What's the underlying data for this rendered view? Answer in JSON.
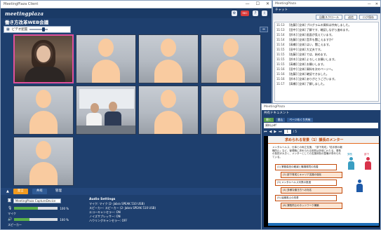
{
  "main_window": {
    "title": "MeetingPlaza Client",
    "controls": [
      "—",
      "☐",
      "✕"
    ],
    "brand": "meetingplaza",
    "toolbar_icons": [
      "settings-icon",
      "rec-icon",
      "help-icon",
      "info-icon"
    ],
    "toolbar_labels": [
      "⚙",
      "REC",
      "?",
      "i"
    ],
    "room_title": "働き方改革WEB会議",
    "layout_label": "ビデオ配置",
    "right_icon": "⇔"
  },
  "video_tiles": [
    {
      "kind": "photo",
      "active": true,
      "caption": ""
    },
    {
      "kind": "avatar"
    },
    {
      "kind": "avatar"
    },
    {
      "kind": "avatar"
    },
    {
      "kind": "avatar"
    },
    {
      "kind": "photo2",
      "caption": ""
    },
    {
      "kind": "avatar"
    },
    {
      "kind": "avatar"
    },
    {
      "kind": "avatar"
    }
  ],
  "control_bar": {
    "tabs": [
      "発言",
      "共有",
      "管理"
    ]
  },
  "devices": {
    "camera_select": "MeetingPlaza CaptureDevice",
    "mic_label": "マイク",
    "mic_level_value": "100 %",
    "mic_level": 0.55,
    "speaker_label": "スピーカー",
    "speaker_level_value": "100 %",
    "speaker_level": 0.35
  },
  "audio_settings": {
    "header": "Audio Settings",
    "lines": [
      "マイク: マイク (2- Jabra SPEAK 510 USB)",
      "スピーカー: スピーカー (2- Jabra SPEAK 510 USB)",
      "エコーキャンセラー: ON",
      "ノイズサプレッサー: ON",
      "ハウリングキャンセラー: OFF"
    ]
  },
  "chat_window": {
    "title": "MeetingPlaza",
    "header": "チャット",
    "buttons": [
      "自動スクロール",
      "送信",
      "ログ保存"
    ],
    "messages": [
      {
        "time": "11:13",
        "text": "[佐藤] [全体] プログラムの資料は共有しました。"
      },
      {
        "time": "11:13",
        "text": "[田中] [全体] 了解です、確認しながら進めます。"
      },
      {
        "time": "11:14",
        "text": "[鈴木] [全体] 画面が見えています。"
      },
      {
        "time": "11:14",
        "text": "[佐藤] [全体] 音声も聞こえますか？"
      },
      {
        "time": "11:14",
        "text": "[高橋] [全体] はい、聞こえます。"
      },
      {
        "time": "11:15",
        "text": "[田中] [全体] 大丈夫です。"
      },
      {
        "time": "11:15",
        "text": "[佐藤] [全体] では、始めます。"
      },
      {
        "time": "11:15",
        "text": "[鈴木] [全体] よろしくお願いします。"
      },
      {
        "time": "11:15",
        "text": "[高橋] [全体] お願いします。"
      },
      {
        "time": "11:16",
        "text": "[田中] [全体] 資料を次のページへ。"
      },
      {
        "time": "11:16",
        "text": "[佐藤] [全体] 確認できました。"
      },
      {
        "time": "11:16",
        "text": "[鈴木] [全体] ありがとうございます。"
      },
      {
        "time": "11:17",
        "text": "[高橋] [全体] 了解しました。"
      }
    ]
  },
  "doc_window": {
    "title": "MeetingPlaza",
    "header": "共有ドキュメント",
    "tabs": [
      "開く",
      "書込",
      "ページめくり共有"
    ],
    "file_name": "資料.pdf",
    "nav_icons": [
      "⏮",
      "◀",
      "▶",
      "⏭"
    ],
    "page_current": "1",
    "page_total": "/ 5",
    "slide_title": "求められる背景（1）課長のメンター",
    "slide_body": "メンタルヘルス、仕事との両立支援、「部下育成」「若手層の離職防止」など、管理職に求められる役割は多岐にわたる。課長の負担が大きく、メンターとしての支援体制の整備が求められている。",
    "slide_boxes": [
      "(1) 業務負担の軽減と職場環境の改善",
      "(2) 部下育成とキャリア支援の強化",
      "(3) メンタルヘルス対策の推進",
      "(4) 多様な働き方への対応",
      "(5) 組織風土の改革",
      "(6) 課長同士のネットワーク構築"
    ],
    "slide_figure_labels": [
      "課長",
      "部下"
    ],
    "figure_colors": {
      "male": "#1e5aa8",
      "female": "#d8334a",
      "neutral": "#3a9ec2"
    }
  }
}
